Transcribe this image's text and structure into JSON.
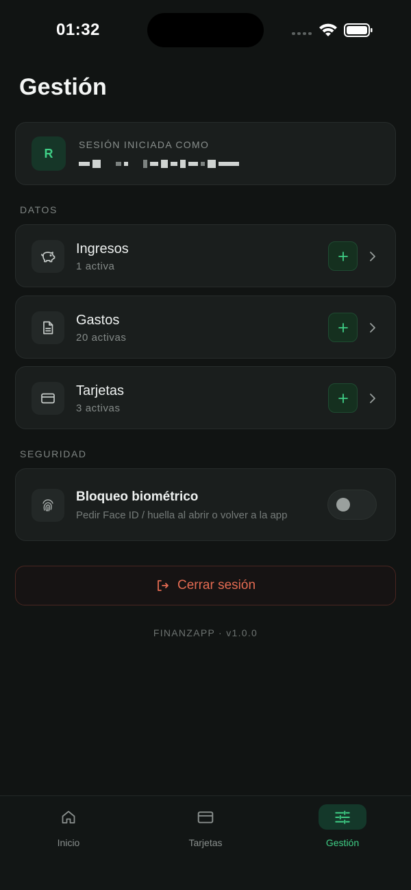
{
  "status_bar": {
    "time": "01:32"
  },
  "page": {
    "title": "Gestión"
  },
  "session": {
    "avatar_initial": "R",
    "label": "SESIÓN INICIADA COMO"
  },
  "sections": {
    "datos": "DATOS",
    "seguridad": "SEGURIDAD"
  },
  "data_rows": [
    {
      "title": "Ingresos",
      "subtitle": "1 activa",
      "icon": "piggy-bank-icon",
      "add": "+"
    },
    {
      "title": "Gastos",
      "subtitle": "20 activas",
      "icon": "document-icon",
      "add": "+"
    },
    {
      "title": "Tarjetas",
      "subtitle": "3 activas",
      "icon": "credit-card-icon",
      "add": "+"
    }
  ],
  "biometric": {
    "title": "Bloqueo biométrico",
    "subtitle": "Pedir Face ID / huella al abrir o volver a la app",
    "enabled": false
  },
  "logout": {
    "label": "Cerrar sesión"
  },
  "footer": {
    "version": "FINANZAPP · v1.0.0"
  },
  "tabbar": {
    "items": [
      {
        "label": "Inicio",
        "icon": "home-icon",
        "active": false
      },
      {
        "label": "Tarjetas",
        "icon": "credit-card-icon",
        "active": false
      },
      {
        "label": "Gestión",
        "icon": "sliders-icon",
        "active": true
      }
    ]
  },
  "colors": {
    "background": "#111413",
    "card": "#1a1e1d",
    "accent_green": "#3fcf86",
    "danger": "#e46b52"
  }
}
